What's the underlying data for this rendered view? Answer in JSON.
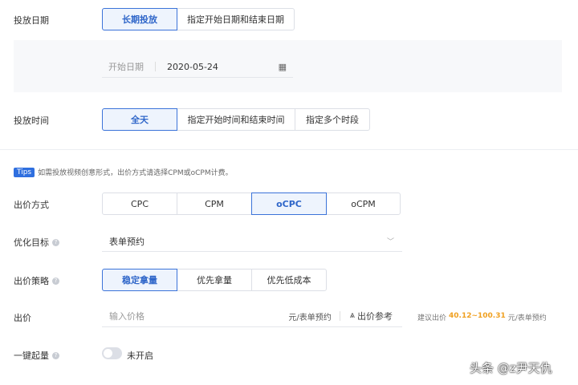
{
  "schedule": {
    "label": "投放日期",
    "options": [
      "长期投放",
      "指定开始日期和结束日期"
    ],
    "selected": 0,
    "start_label": "开始日期",
    "start_value": "2020-05-24"
  },
  "time": {
    "label": "投放时间",
    "options": [
      "全天",
      "指定开始时间和结束时间",
      "指定多个时段"
    ],
    "selected": 0
  },
  "tips": {
    "badge": "Tips",
    "text": "如需投放视频创意形式，出价方式请选择CPM或oCPM计费。"
  },
  "bid_method": {
    "label": "出价方式",
    "options": [
      "CPC",
      "CPM",
      "oCPC",
      "oCPM"
    ],
    "selected": 2
  },
  "goal": {
    "label": "优化目标",
    "value": "表单预约"
  },
  "strategy": {
    "label": "出价策略",
    "options": [
      "稳定拿量",
      "优先拿量",
      "优先低成本"
    ],
    "selected": 0
  },
  "bid": {
    "label": "出价",
    "placeholder": "输入价格",
    "unit": "元/表单预约",
    "reference": "出价参考",
    "suggest_prefix": "建议出价",
    "suggest_range": "40.12~100.31",
    "suggest_unit": "元/表单预约"
  },
  "boost": {
    "label": "一键起量",
    "state": "未开启"
  },
  "watermark": "头条 @z尹天仇",
  "colors": {
    "accent": "#3b73d9",
    "orange": "#f0a020"
  }
}
